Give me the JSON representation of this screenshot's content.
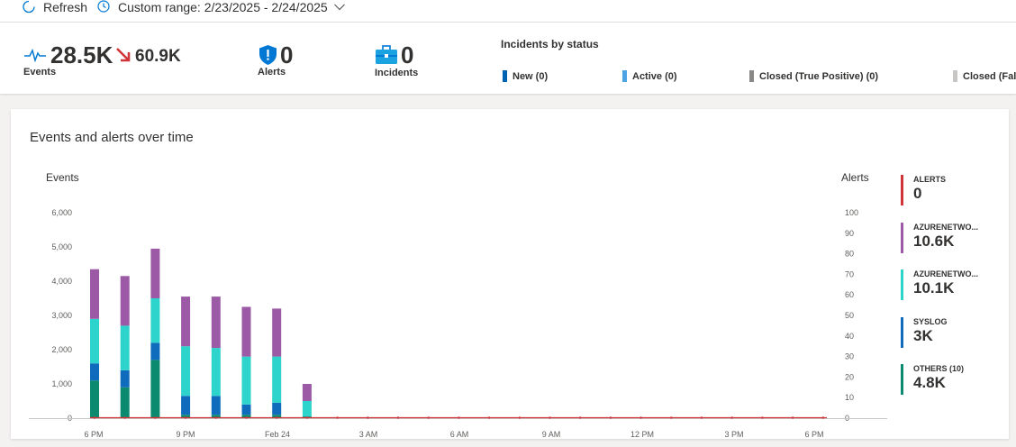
{
  "toolbar": {
    "refresh_label": "Refresh",
    "range_label": "Custom range: 2/23/2025 - 2/24/2025"
  },
  "summary": {
    "events": {
      "value": "28.5K",
      "trend_value": "60.9K",
      "label": "Events",
      "icon": "pulse-icon",
      "trend_icon": "trend-down-arrow-icon"
    },
    "alerts": {
      "value": "0",
      "label": "Alerts",
      "icon": "shield-icon"
    },
    "incidents": {
      "value": "0",
      "label": "Incidents",
      "icon": "briefcase-icon"
    }
  },
  "incidents_by_status": {
    "title": "Incidents by status",
    "items": [
      {
        "label": "New (0)",
        "color": "#0063b1"
      },
      {
        "label": "Active (0)",
        "color": "#4ba3e3"
      },
      {
        "label": "Closed (True Positive) (0)",
        "color": "#8a8886"
      },
      {
        "label": "Closed (Fal",
        "color": "#c8c6c4"
      }
    ]
  },
  "card": {
    "title": "Events and alerts over time"
  },
  "chart_data": {
    "type": "bar",
    "y_left_label": "Events",
    "y_right_label": "Alerts",
    "y_left_ticks": [
      "0",
      "1,000",
      "2,000",
      "3,000",
      "4,000",
      "5,000",
      "6,000"
    ],
    "y_right_ticks": [
      "0",
      "10",
      "20",
      "30",
      "40",
      "50",
      "60",
      "70",
      "80",
      "90",
      "100"
    ],
    "ylim": [
      0,
      6000
    ],
    "y2lim": [
      0,
      100
    ],
    "x_ticks": [
      "6 PM",
      "9 PM",
      "Feb 24",
      "3 AM",
      "6 AM",
      "9 AM",
      "12 PM",
      "3 PM",
      "6 PM"
    ],
    "series": [
      {
        "name": "OTHERS (10)",
        "color": "#0b8a6f",
        "values": [
          1100,
          900,
          1700,
          100,
          100,
          100,
          100,
          50,
          0
        ]
      },
      {
        "name": "SYSLOG",
        "color": "#0f6cbd",
        "values": [
          500,
          500,
          500,
          550,
          550,
          300,
          350,
          0,
          0
        ]
      },
      {
        "name": "AZURENETWO...",
        "color": "#2dd4cc",
        "values": [
          1300,
          1300,
          1300,
          1450,
          1400,
          1400,
          1350,
          450,
          0
        ]
      },
      {
        "name": "AZURENETWO...",
        "color": "#9b59a6",
        "values": [
          1450,
          1450,
          1450,
          1450,
          1500,
          1450,
          1400,
          500,
          0
        ]
      }
    ],
    "alerts_line": {
      "name": "ALERTS",
      "color": "#d13438",
      "value": 0
    }
  },
  "legend": [
    {
      "name": "ALERTS",
      "value": "0",
      "color": "#d13438"
    },
    {
      "name": "AZURENETWO...",
      "value": "10.6K",
      "color": "#9b59a6"
    },
    {
      "name": "AZURENETWO...",
      "value": "10.1K",
      "color": "#2dd4cc"
    },
    {
      "name": "SYSLOG",
      "value": "3K",
      "color": "#0f6cbd"
    },
    {
      "name": "OTHERS (10)",
      "value": "4.8K",
      "color": "#0b8a6f"
    }
  ]
}
